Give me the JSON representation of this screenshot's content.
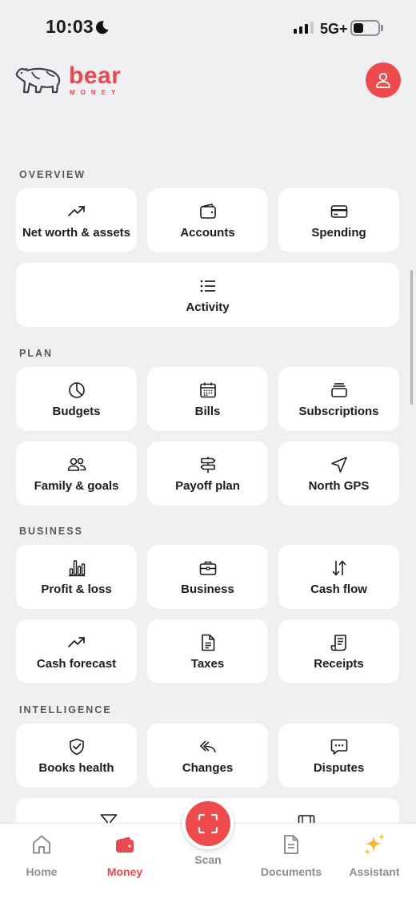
{
  "status_bar": {
    "time": "10:03",
    "network": "5G+"
  },
  "header": {
    "brand_name": "bear",
    "brand_sub": "MONEY",
    "profile_icon": "person-icon"
  },
  "sections": {
    "overview": {
      "title": "OVERVIEW",
      "items": [
        {
          "label": "Net worth & assets",
          "icon": "trend-up-icon"
        },
        {
          "label": "Accounts",
          "icon": "wallet-icon"
        },
        {
          "label": "Spending",
          "icon": "credit-card-icon"
        },
        {
          "label": "Activity",
          "icon": "list-icon"
        }
      ]
    },
    "plan": {
      "title": "PLAN",
      "items": [
        {
          "label": "Budgets",
          "icon": "pie-chart-icon"
        },
        {
          "label": "Bills",
          "icon": "calendar-icon"
        },
        {
          "label": "Subscriptions",
          "icon": "stack-icon"
        },
        {
          "label": "Family & goals",
          "icon": "people-icon"
        },
        {
          "label": "Payoff plan",
          "icon": "signpost-icon"
        },
        {
          "label": "North GPS",
          "icon": "navigation-icon"
        }
      ]
    },
    "business": {
      "title": "BUSINESS",
      "items": [
        {
          "label": "Profit & loss",
          "icon": "bar-chart-icon"
        },
        {
          "label": "Business",
          "icon": "briefcase-icon"
        },
        {
          "label": "Cash flow",
          "icon": "arrows-up-down-icon"
        },
        {
          "label": "Cash forecast",
          "icon": "trend-up-icon"
        },
        {
          "label": "Taxes",
          "icon": "document-icon"
        },
        {
          "label": "Receipts",
          "icon": "receipt-icon"
        }
      ]
    },
    "intelligence": {
      "title": "INTELLIGENCE",
      "items": [
        {
          "label": "Books health",
          "icon": "shield-check-icon"
        },
        {
          "label": "Changes",
          "icon": "undo-arrow-icon"
        },
        {
          "label": "Disputes",
          "icon": "chat-bubble-icon"
        }
      ]
    }
  },
  "bottom_nav": {
    "home": "Home",
    "money": "Money",
    "scan": "Scan",
    "documents": "Documents",
    "assistant": "Assistant",
    "active": "Money"
  },
  "colors": {
    "brand": "#e84a4f",
    "background": "#f0f0f3",
    "card": "#ffffff",
    "inactive": "#8e8e93"
  }
}
